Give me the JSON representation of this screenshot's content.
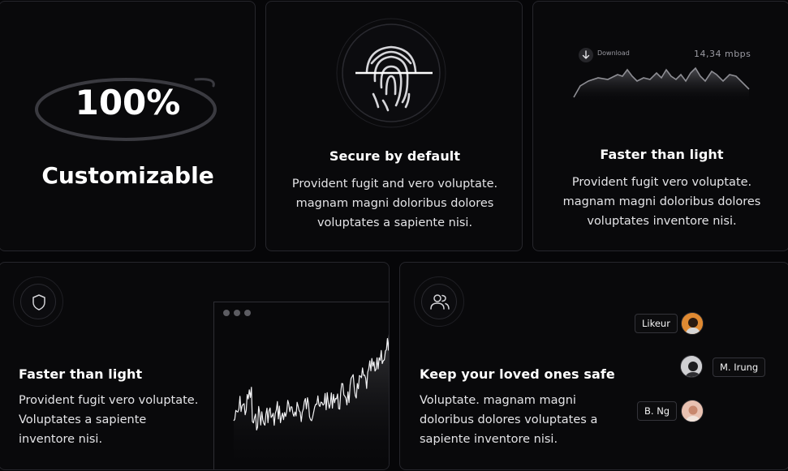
{
  "card_customizable": {
    "percent": "100%",
    "label": "Customizable"
  },
  "card_secure": {
    "title": "Secure by default",
    "desc": [
      "Provident fugit and vero voluptate.",
      "magnam magni doloribus dolores",
      "voluptates a sapiente nisi."
    ]
  },
  "card_speed": {
    "download_label": "Download",
    "speed": "14,34 mbps",
    "title": "Faster than light",
    "desc": [
      "Provident fugit vero voluptate.",
      "magnam magni doloribus dolores",
      "voluptates inventore nisi."
    ]
  },
  "card_chart": {
    "title": "Faster than light",
    "desc": [
      "Provident fugit vero voluptate.",
      "Voluptates a sapiente",
      "inventore nisi."
    ]
  },
  "card_people": {
    "title": "Keep your loved ones safe",
    "desc": [
      "Voluptate. magnam magni",
      "doloribus dolores voluptates a",
      "sapiente inventore nisi."
    ],
    "people": [
      {
        "name": "Likeur",
        "avatar_color": "#d1823a"
      },
      {
        "name": "M. Irung",
        "avatar_color": "#b9b9bd"
      },
      {
        "name": "B. Ng",
        "avatar_color": "#d8a896"
      }
    ]
  },
  "icons": {
    "fingerprint": "fingerprint-icon",
    "download": "download-arrow-icon",
    "shield": "shield-icon",
    "users": "users-icon"
  },
  "colors": {
    "background": "#060608",
    "card": "#09090b",
    "border": "#26262c",
    "text": "#ffffff",
    "muted": "#9a9aa2"
  }
}
